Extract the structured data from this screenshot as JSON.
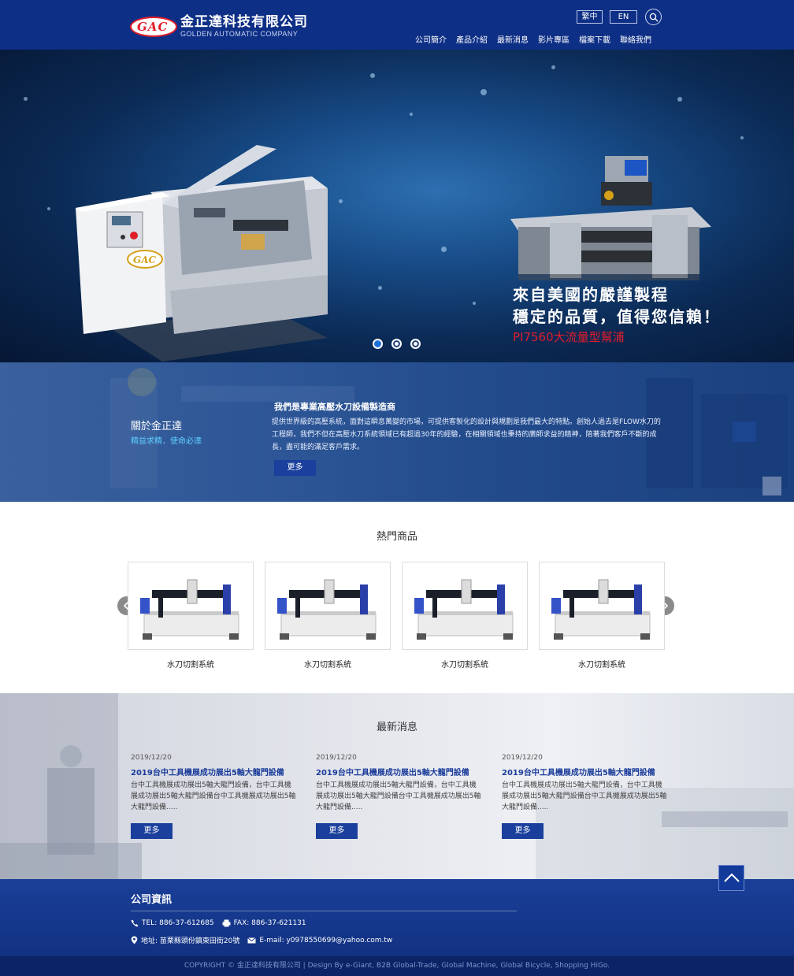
{
  "header": {
    "logo_mark": "GAC",
    "company_cn": "金正達科技有限公司",
    "company_en": "GOLDEN AUTOMATIC COMPANY",
    "lang_tc": "繁中",
    "lang_en": "EN",
    "nav": [
      "公司簡介",
      "產品介紹",
      "最新消息",
      "影片專區",
      "檔案下載",
      "聯絡我們"
    ],
    "bg_color": "#0e2f86"
  },
  "hero": {
    "line1": "來自美國的嚴謹製程",
    "line2": "穩定的品質，值得您信賴！",
    "line3": "PI7560大流量型幫浦",
    "machine_logo": "GAC",
    "slides": 3,
    "active_slide": 1
  },
  "about": {
    "title": "關於金正達",
    "subtitle": "精益求精．使命必達",
    "heading": "我們是專業高壓水刀設備製造商",
    "body": "提供世界級的高壓系統，面對這瞬息萬變的市場，可提供客製化的設計與規劃是我們最大的特點。創始人過去是FLOW水刀的工程師，我們不但在高壓水刀系統領域已有超過30年的經驗，在相關領域也秉持的廣師求益的精神，陪著我們客戶不斷的成長，盡可能的滿足客戶需求。",
    "more": "更多"
  },
  "products": {
    "title": "熱門商品",
    "items": [
      {
        "caption": "水刀切割系統"
      },
      {
        "caption": "水刀切割系統"
      },
      {
        "caption": "水刀切割系統"
      },
      {
        "caption": "水刀切割系統"
      }
    ]
  },
  "news": {
    "title": "最新消息",
    "items": [
      {
        "date": "2019/12/20",
        "headline": "2019台中工具機展成功展出5軸大龍門設備",
        "body": "台中工具機展成功展出5軸大龍門設備，台中工具機展成功展出5軸大龍門設備台中工具機展成功展出5軸大龍門設備.....",
        "more": "更多"
      },
      {
        "date": "2019/12/20",
        "headline": "2019台中工具機展成功展出5軸大龍門設備",
        "body": "台中工具機展成功展出5軸大龍門設備，台中工具機展成功展出5軸大龍門設備台中工具機展成功展出5軸大龍門設備.....",
        "more": "更多"
      },
      {
        "date": "2019/12/20",
        "headline": "2019台中工具機展成功展出5軸大龍門設備",
        "body": "台中工具機展成功展出5軸大龍門設備，台中工具機展成功展出5軸大龍門設備台中工具機展成功展出5軸大龍門設備.....",
        "more": "更多"
      }
    ]
  },
  "footer": {
    "title": "公司資訊",
    "tel": "TEL: 886-37-612685",
    "fax": "FAX: 886-37-621131",
    "address": "地址: 苗栗縣頭份鎮東田街20號",
    "email": "E-mail: y0978550699@yahoo.com.tw",
    "copyright": "COPYRIGHT © 金正達科技有限公司 | Design By  e-Giant, B2B Global-Trade, Global Machine, Global Bicycle, Shopping HiGo."
  }
}
